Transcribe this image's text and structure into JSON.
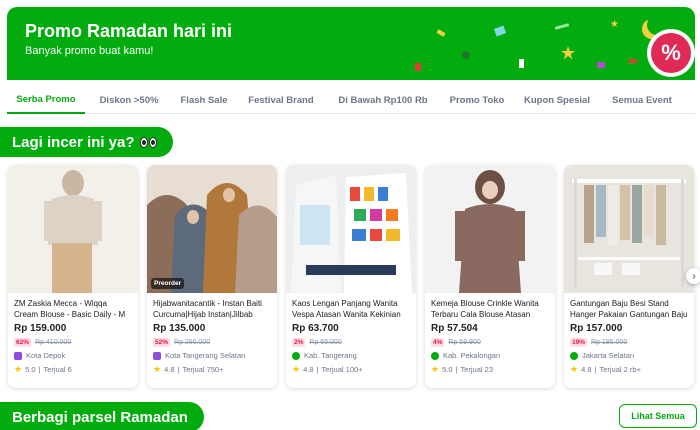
{
  "banner": {
    "title": "Promo Ramadan hari ini",
    "subtitle": "Banyak promo buat kamu!",
    "badge_icon": "percent-icon"
  },
  "tabs": [
    {
      "label": "Serba Promo",
      "active": true
    },
    {
      "label": "Diskon >50%",
      "active": false
    },
    {
      "label": "Flash Sale",
      "active": false
    },
    {
      "label": "Festival Brand",
      "active": false
    },
    {
      "label": "Di Bawah Rp100 Rb",
      "active": false
    },
    {
      "label": "Promo Toko",
      "active": false
    },
    {
      "label": "Kupon Spesial",
      "active": false
    },
    {
      "label": "Semua Event",
      "active": false
    }
  ],
  "section1": {
    "title": "Lagi incer ini ya?"
  },
  "section2": {
    "title": "Berbagi parsel Ramadan",
    "see_all": "Lihat Semua"
  },
  "products": [
    {
      "name": "ZM Zaskia Mecca - Wiqqa Cream Blouse - Basic Daily - M",
      "price": "Rp 159.000",
      "discount": "62%",
      "original": "Rp 410.000",
      "location": "Kota Depok",
      "rating": "5.0",
      "sold": "Terjual 6",
      "shop_badge": "power-merchant-icon",
      "preorder": ""
    },
    {
      "name": "Hijabwanitacantik - Instan Baiti Curcuma|Hijab Instan|Jilbab Instan...",
      "price": "Rp 135.000",
      "discount": "52%",
      "original": "Rp 280.000",
      "location": "Kota Tangerang Selatan",
      "rating": "4.8",
      "sold": "Terjual 750+",
      "shop_badge": "power-merchant-icon",
      "preorder": "Preorder"
    },
    {
      "name": "Kaos Lengan Panjang Wanita Vespa Atasan Wanita Kekinian Terlaris - ...",
      "price": "Rp 63.700",
      "discount": "2%",
      "original": "Rp 65.000",
      "location": "Kab. Tangerang",
      "rating": "4.8",
      "sold": "Terjual 100+",
      "shop_badge": "pro-merchant-icon",
      "preorder": ""
    },
    {
      "name": "Kemeja Blouse Crinkle Wanita Terbaru Cala Blouse Atasan Wanit...",
      "price": "Rp 57.504",
      "discount": "4%",
      "original": "Rp 59.900",
      "location": "Kab. Pekalongan",
      "rating": "5.0",
      "sold": "Terjual 23",
      "shop_badge": "pro-merchant-icon",
      "preorder": ""
    },
    {
      "name": "Gantungan Baju Besi Stand Hanger Pakaian Gantungan Baju Berdiri - ...",
      "price": "Rp 157.000",
      "discount": "19%",
      "original": "Rp 195.000",
      "location": "Jakarta Selatan",
      "rating": "4.8",
      "sold": "Terjual 2 rb+",
      "shop_badge": "pro-merchant-icon",
      "preorder": ""
    }
  ],
  "colors": {
    "brand": "#03ac0e",
    "discount": "#ef144a",
    "star": "#ffc400",
    "merchant_purple": "#8f4ae0"
  }
}
